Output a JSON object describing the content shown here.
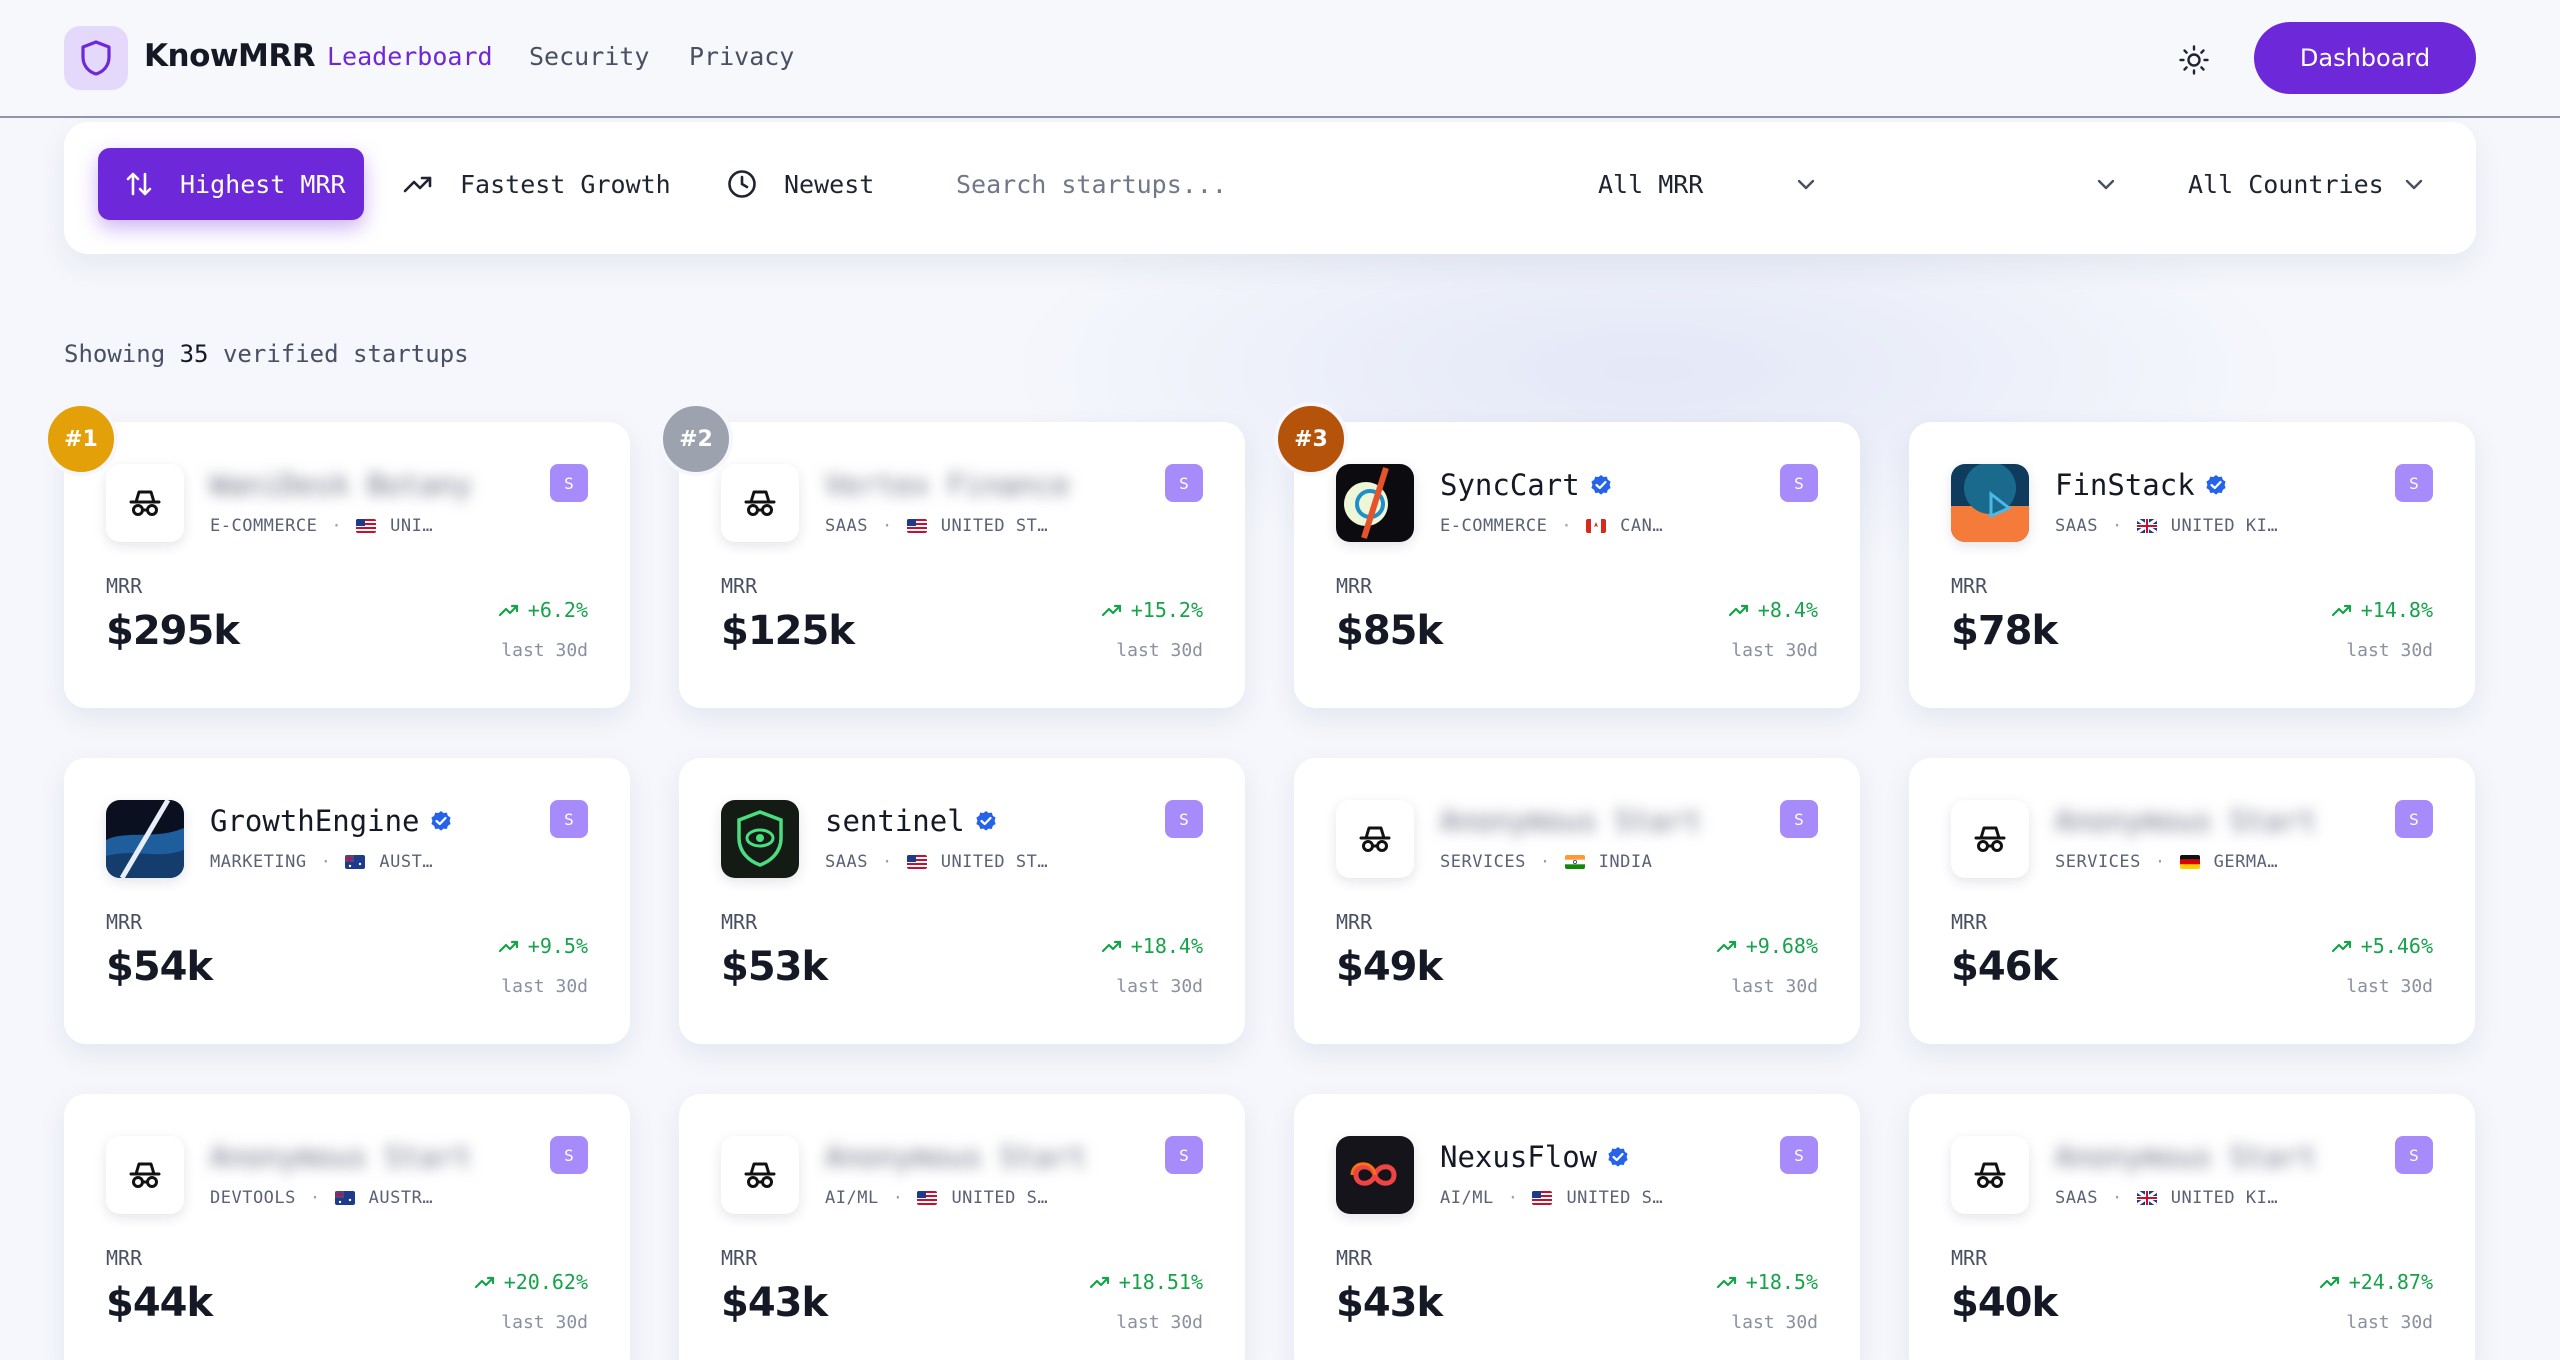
{
  "nav": {
    "brand": "KnowMRR",
    "links": [
      "Leaderboard",
      "Security",
      "Privacy"
    ],
    "dashboard_label": "Dashboard"
  },
  "filters": {
    "sorts": [
      "Highest MRR",
      "Fastest Growth",
      "Newest"
    ],
    "search_placeholder": "Search startups...",
    "mrr_select": "All MRR",
    "category_select": "",
    "country_select": "All Countries"
  },
  "summary": {
    "prefix": "Showing",
    "count": "35",
    "suffix": "verified startups"
  },
  "colors": {
    "accent": "#6d28d9",
    "growth": "#16a34a",
    "rank1": "#e3a008",
    "rank2": "#9ca3af",
    "rank3": "#b45309"
  },
  "cards": [
    {
      "rank": "#1",
      "name": "WaniDesk Botany",
      "verified": false,
      "anonymous": true,
      "category": "E-COMMERCE",
      "country": "UNI…",
      "badge": "S",
      "mrr_label": "MRR",
      "mrr": "$295k",
      "growth": "+6.2%",
      "period": "last 30d",
      "icon": "incognito-icon"
    },
    {
      "rank": "#2",
      "name": "Vertex Finance",
      "verified": false,
      "anonymous": true,
      "category": "SAAS",
      "country": "UNITED ST…",
      "badge": "S",
      "mrr_label": "MRR",
      "mrr": "$125k",
      "growth": "+15.2%",
      "period": "last 30d",
      "icon": "incognito-icon"
    },
    {
      "rank": "#3",
      "name": "SyncCart",
      "verified": true,
      "anonymous": false,
      "category": "E-COMMERCE",
      "country": "CAN…",
      "badge": "S",
      "mrr_label": "MRR",
      "mrr": "$85k",
      "growth": "+8.4%",
      "period": "last 30d",
      "icon": "synccart-logo-icon"
    },
    {
      "rank": "",
      "name": "FinStack",
      "verified": true,
      "anonymous": false,
      "category": "SAAS",
      "country": "UNITED KI…",
      "badge": "S",
      "mrr_label": "MRR",
      "mrr": "$78k",
      "growth": "+14.8%",
      "period": "last 30d",
      "icon": "finstack-logo-icon"
    },
    {
      "rank": "",
      "name": "GrowthEngine",
      "verified": true,
      "anonymous": false,
      "category": "MARKETING",
      "country": "AUST…",
      "badge": "S",
      "mrr_label": "MRR",
      "mrr": "$54k",
      "growth": "+9.5%",
      "period": "last 30d",
      "icon": "growthengine-logo-icon"
    },
    {
      "rank": "",
      "name": "sentinel",
      "verified": true,
      "anonymous": false,
      "category": "SAAS",
      "country": "UNITED ST…",
      "badge": "S",
      "mrr_label": "MRR",
      "mrr": "$53k",
      "growth": "+18.4%",
      "period": "last 30d",
      "icon": "sentinel-logo-icon"
    },
    {
      "rank": "",
      "name": "Anonymous Start",
      "verified": false,
      "anonymous": true,
      "category": "SERVICES",
      "country": "INDIA",
      "badge": "S",
      "mrr_label": "MRR",
      "mrr": "$49k",
      "growth": "+9.68%",
      "period": "last 30d",
      "icon": "incognito-icon"
    },
    {
      "rank": "",
      "name": "Anonymous Start",
      "verified": false,
      "anonymous": true,
      "category": "SERVICES",
      "country": "GERMA…",
      "badge": "S",
      "mrr_label": "MRR",
      "mrr": "$46k",
      "growth": "+5.46%",
      "period": "last 30d",
      "icon": "incognito-icon"
    },
    {
      "rank": "",
      "name": "Anonymous Start",
      "verified": false,
      "anonymous": true,
      "category": "DEVTOOLS",
      "country": "AUSTR…",
      "badge": "S",
      "mrr_label": "MRR",
      "mrr": "$44k",
      "growth": "+20.62%",
      "period": "last 30d",
      "icon": "incognito-icon"
    },
    {
      "rank": "",
      "name": "Anonymous Start",
      "verified": false,
      "anonymous": true,
      "category": "AI/ML",
      "country": "UNITED S…",
      "badge": "S",
      "mrr_label": "MRR",
      "mrr": "$43k",
      "growth": "+18.51%",
      "period": "last 30d",
      "icon": "incognito-icon"
    },
    {
      "rank": "",
      "name": "NexusFlow",
      "verified": true,
      "anonymous": false,
      "category": "AI/ML",
      "country": "UNITED S…",
      "badge": "S",
      "mrr_label": "MRR",
      "mrr": "$43k",
      "growth": "+18.5%",
      "period": "last 30d",
      "icon": "nexusflow-logo-icon"
    },
    {
      "rank": "",
      "name": "Anonymous Start",
      "verified": false,
      "anonymous": true,
      "category": "SAAS",
      "country": "UNITED KI…",
      "badge": "S",
      "mrr_label": "MRR",
      "mrr": "$40k",
      "growth": "+24.87%",
      "period": "last 30d",
      "icon": "incognito-icon"
    }
  ]
}
